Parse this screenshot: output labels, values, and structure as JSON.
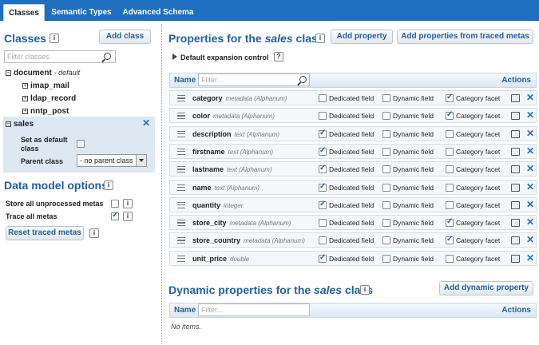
{
  "tabs": [
    {
      "label": "Classes"
    },
    {
      "label": "Semantic Types"
    },
    {
      "label": "Advanced Schema"
    }
  ],
  "left": {
    "title": "Classes",
    "add_class": "Add class",
    "filter_placeholder": "Filter classes",
    "tree": {
      "root": "document",
      "root_note": "- default",
      "children": [
        "imap_mail",
        "ldap_record",
        "nntp_post"
      ]
    },
    "selected": {
      "name": "sales",
      "set_default_label": "Set as default class",
      "parent_label": "Parent class",
      "parent_value": "- no parent class"
    },
    "data_model": {
      "title": "Data model options",
      "store_label": "Store all unprocessed metas",
      "trace_label": "Trace all metas",
      "reset_label": "Reset traced metas"
    }
  },
  "right": {
    "props_title_prefix": "Properties for the ",
    "class_name": "sales",
    "props_title_suffix": " class",
    "add_property": "Add property",
    "add_from_traced": "Add properties from traced metas",
    "default_expansion": "Default expansion control",
    "col_name": "Name",
    "col_actions": "Actions",
    "filter_placeholder": "Filter...",
    "opt_dedicated": "Dedicated field",
    "opt_dynamic": "Dynamic field",
    "opt_category": "Category facet",
    "properties": [
      {
        "name": "category",
        "type": "metadata (Alphanum)",
        "dedicated": false,
        "dynamic": false,
        "category": true
      },
      {
        "name": "color",
        "type": "metadata (Alphanum)",
        "dedicated": false,
        "dynamic": false,
        "category": true
      },
      {
        "name": "description",
        "type": "text (Alphanum)",
        "dedicated": true,
        "dynamic": false,
        "category": false
      },
      {
        "name": "firstname",
        "type": "text (Alphanum)",
        "dedicated": true,
        "dynamic": false,
        "category": false
      },
      {
        "name": "lastname",
        "type": "text (Alphanum)",
        "dedicated": true,
        "dynamic": false,
        "category": false
      },
      {
        "name": "name",
        "type": "text (Alphanum)",
        "dedicated": true,
        "dynamic": false,
        "category": false
      },
      {
        "name": "quantity",
        "type": "integer",
        "dedicated": true,
        "dynamic": false,
        "category": false
      },
      {
        "name": "store_city",
        "type": "metadata (Alphanum)",
        "dedicated": false,
        "dynamic": false,
        "category": true
      },
      {
        "name": "store_country",
        "type": "metadata (Alphanum)",
        "dedicated": false,
        "dynamic": false,
        "category": true
      },
      {
        "name": "unit_price",
        "type": "double",
        "dedicated": true,
        "dynamic": false,
        "category": false
      }
    ],
    "dyn_title_prefix": "Dynamic properties for the ",
    "dyn_title_suffix": " class",
    "add_dynamic": "Add dynamic property",
    "no_items": "No items."
  },
  "colors": {
    "accent": "#1f5fa8",
    "tabbar": "#1f6fbf",
    "row_bg": "#f5f8fb",
    "selected_bg": "#dde8f3"
  }
}
